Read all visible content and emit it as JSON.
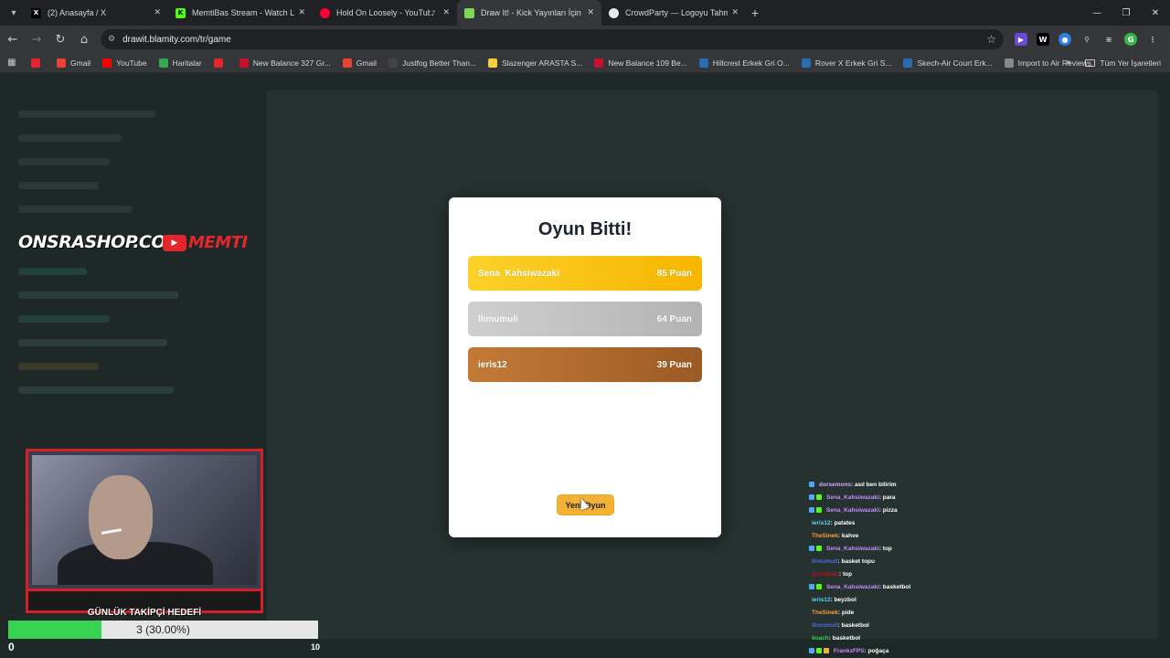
{
  "browser": {
    "tabs": [
      {
        "title": "(2) Anasayfa / X",
        "icon": "x-icon",
        "color": "#000000",
        "active": false
      },
      {
        "title": "MemtiBas Stream - Watch Live",
        "icon": "kick-icon",
        "color": "#53fc18",
        "active": false
      },
      {
        "title": "Hold On Loosely - YouTube",
        "icon": "youtube-music-icon",
        "color": "#ff0033",
        "active": false,
        "audio": true
      },
      {
        "title": "Draw It! - Kick Yayınları İçin Çizim",
        "icon": "drawit-icon",
        "color": "#7fd858",
        "active": true
      },
      {
        "title": "CrowdParty — Logoyu Tahmin Et",
        "icon": "crowdparty-icon",
        "color": "#222222",
        "active": false
      }
    ],
    "url": "drawit.blamity.com/tr/game",
    "bookmarks": [
      {
        "label": "",
        "color": "#e3262c"
      },
      {
        "label": "Gmail",
        "color": "#ea4335"
      },
      {
        "label": "YouTube",
        "color": "#ff0000"
      },
      {
        "label": "Haritalar",
        "color": "#34a853"
      },
      {
        "label": "",
        "color": "#e3262c"
      },
      {
        "label": "New Balance 327 Gr...",
        "color": "#c8102e"
      },
      {
        "label": "Gmail",
        "color": "#ea4335"
      },
      {
        "label": "Justfog Better Than...",
        "color": "#444444"
      },
      {
        "label": "Slazenger ARASTA S...",
        "color": "#f4d03f"
      },
      {
        "label": "New Balance 109 Be...",
        "color": "#c8102e"
      },
      {
        "label": "Hillcrest Erkek Gri O...",
        "color": "#2b6cb0"
      },
      {
        "label": "Rover X Erkek Gri S...",
        "color": "#2b6cb0"
      },
      {
        "label": "Skech-Air Court Erk...",
        "color": "#2b6cb0"
      },
      {
        "label": "Import to Air Reviews",
        "color": "#888888"
      }
    ],
    "bookmarks_folder": "Tüm Yer İşaretleri"
  },
  "overlay": {
    "shop_logo_part1": "ONSRA",
    "shop_logo_part2": "SHOP.COM",
    "channel_name": "MEMTI",
    "goal_title": "GÜNLÜK TAKİPÇİ HEDEFİ",
    "goal_text": "3 (30.00%)",
    "goal_progress": 0.3,
    "goal_min": "0",
    "goal_max": "10"
  },
  "modal": {
    "title": "Oyun Bitti!",
    "scores": [
      {
        "name": "Sena_Kahsiwazaki",
        "points": "85 Puan",
        "rank": "gold"
      },
      {
        "name": "llimumuli",
        "points": "64 Puan",
        "rank": "silver"
      },
      {
        "name": "ieris12",
        "points": "39 Puan",
        "rank": "bronze"
      }
    ],
    "new_game_label": "Yeni Oyun"
  },
  "chat": [
    {
      "user": "dorsemons",
      "msg": ": asıl ben bilirim",
      "color": "#d8a6ff",
      "badges": 1
    },
    {
      "user": "Sena_Kahsiwazaki",
      "msg": ": para",
      "color": "#c78bff",
      "badges": 2
    },
    {
      "user": "Sena_Kahsiwazaki",
      "msg": ": pizza",
      "color": "#c78bff",
      "badges": 2
    },
    {
      "user": "ieris12",
      "msg": ": patates",
      "color": "#5bd6ff",
      "badges": 0
    },
    {
      "user": "TheSinek",
      "msg": ": kahve",
      "color": "#ff9a3c",
      "badges": 0
    },
    {
      "user": "Sena_Kahsiwazaki",
      "msg": ": top",
      "color": "#c78bff",
      "badges": 2
    },
    {
      "user": "llimumuli",
      "msg": ": basket topu",
      "color": "#4a6bd8",
      "badges": 0
    },
    {
      "user": "grandpajr",
      "msg": ": top",
      "color": "#b0121c",
      "badges": 0
    },
    {
      "user": "Sena_Kahsiwazaki",
      "msg": ": basketbol",
      "color": "#c78bff",
      "badges": 2
    },
    {
      "user": "ieris12",
      "msg": ": beyzbol",
      "color": "#5bd6ff",
      "badges": 0
    },
    {
      "user": "TheSinek",
      "msg": ": pide",
      "color": "#ff9a3c",
      "badges": 0
    },
    {
      "user": "llimumuli",
      "msg": ": basketbol",
      "color": "#4a6bd8",
      "badges": 0
    },
    {
      "user": "iloach",
      "msg": ": basketbol",
      "color": "#39d353",
      "badges": 0
    },
    {
      "user": "FrankzFPS",
      "msg": ": poğaça",
      "color": "#c78bff",
      "badges": 3
    }
  ]
}
